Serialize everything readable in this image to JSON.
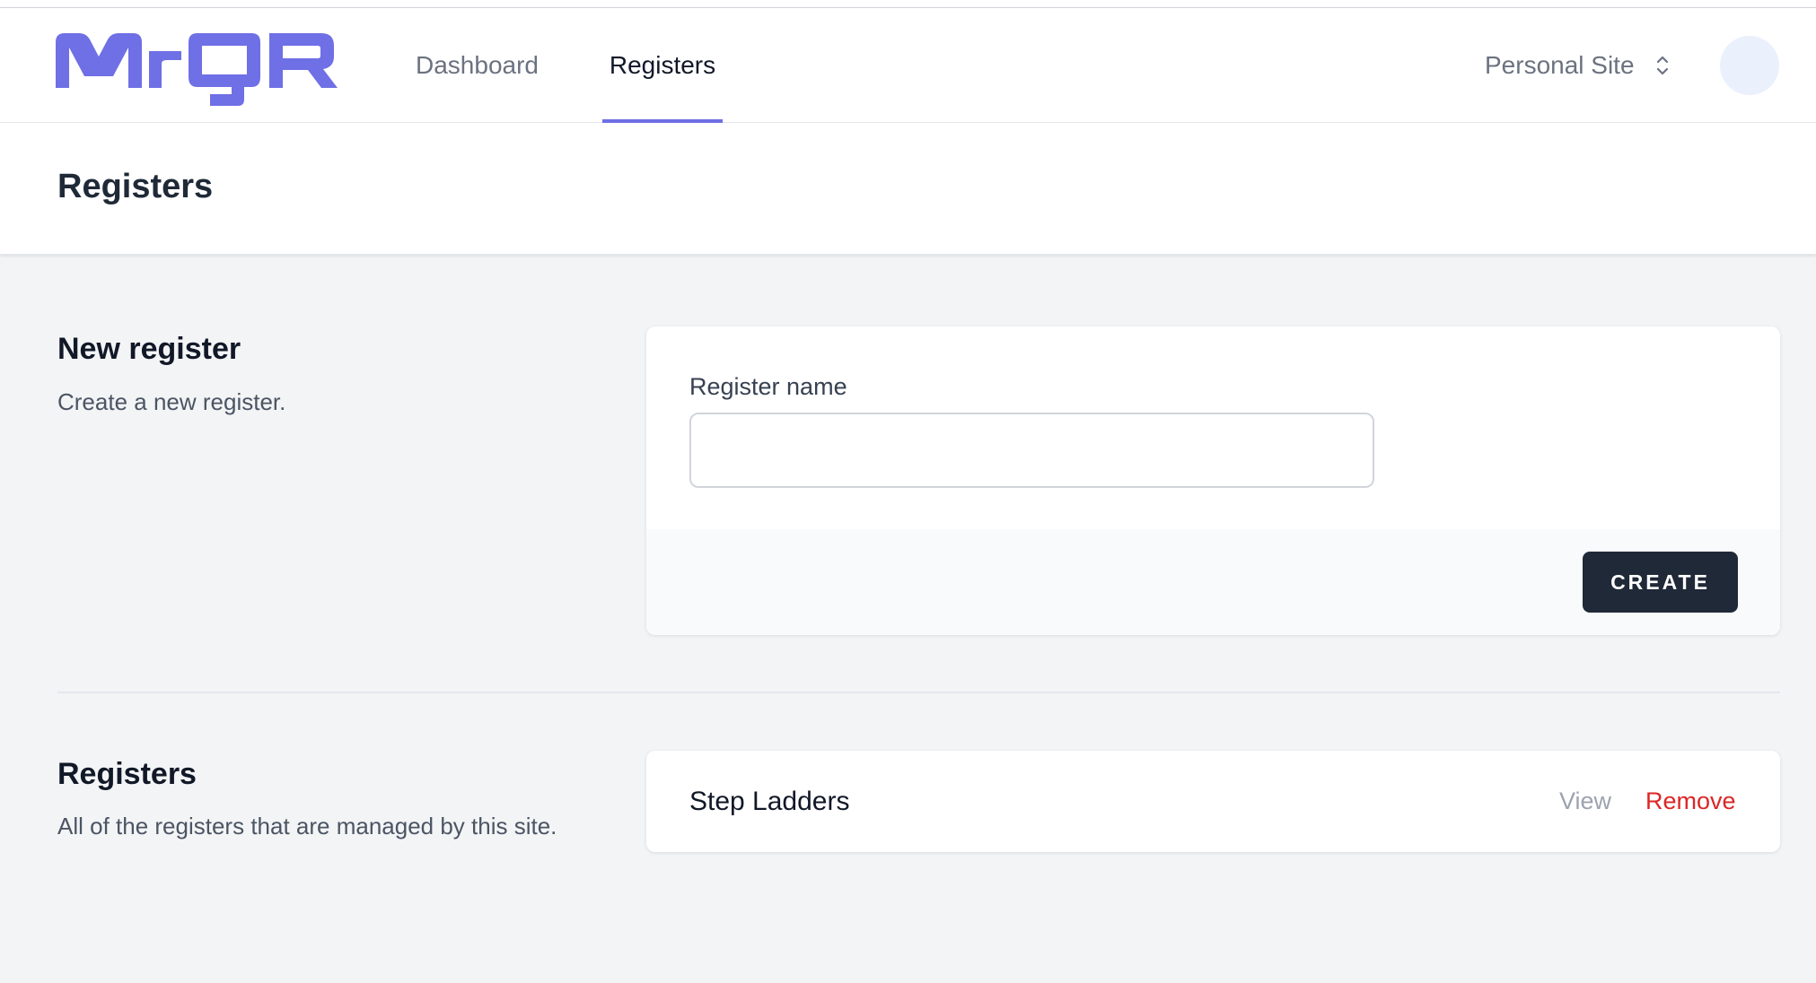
{
  "brand": {
    "logo_text": "MrQR",
    "accent_color": "#6f6fe6"
  },
  "nav": {
    "items": [
      {
        "label": "Dashboard",
        "active": false
      },
      {
        "label": "Registers",
        "active": true
      }
    ],
    "site_switcher": {
      "label": "Personal Site",
      "icon": "chevron-up-down-icon"
    },
    "avatar": {
      "icon": "avatar"
    }
  },
  "header": {
    "title": "Registers"
  },
  "new_register": {
    "title": "New register",
    "description": "Create a new register.",
    "field_label": "Register name",
    "field_value": "",
    "field_placeholder": "",
    "button_label": "CREATE"
  },
  "registers": {
    "title": "Registers",
    "description": "All of the registers that are managed by this site.",
    "items": [
      {
        "name": "Step Ladders",
        "view_label": "View",
        "remove_label": "Remove"
      }
    ]
  },
  "colors": {
    "primary_button": "#1f2937",
    "danger": "#dc2626",
    "muted_link": "#9ca3af"
  }
}
